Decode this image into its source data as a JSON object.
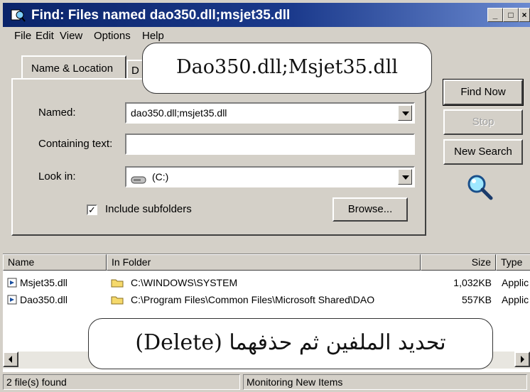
{
  "window": {
    "title": "Find: Files named dao350.dll;msjet35.dll",
    "controls": [
      "_",
      "□",
      "×"
    ]
  },
  "menu": [
    "File",
    "Edit",
    "View",
    "Options",
    "Help"
  ],
  "tabs": [
    {
      "label": "Name & Location",
      "active": true
    },
    {
      "label": "D",
      "active": false
    }
  ],
  "form": {
    "named_label": "Named:",
    "named_value": "dao350.dll;msjet35.dll",
    "containing_label": "Containing text:",
    "containing_value": "",
    "lookin_label": "Look in:",
    "lookin_value": "(C:)",
    "include_subfolders_label": "Include subfolders",
    "include_subfolders_checked": true,
    "browse_label": "Browse..."
  },
  "buttons": {
    "find_now": "Find Now",
    "stop": "Stop",
    "new_search": "New Search"
  },
  "icons": {
    "magnifier": "magnifier-icon",
    "drive": "drive-icon",
    "folder": "folder-icon",
    "file": "dll-file-icon"
  },
  "results": {
    "columns": [
      "Name",
      "In Folder",
      "Size",
      "Type"
    ],
    "rows": [
      {
        "name": "Msjet35.dll",
        "folder": "C:\\WINDOWS\\SYSTEM",
        "size": "1,032KB",
        "type": "Applic"
      },
      {
        "name": "Dao350.dll",
        "folder": "C:\\Program Files\\Common Files\\Microsoft Shared\\DAO",
        "size": "557KB",
        "type": "Applic"
      }
    ]
  },
  "status": {
    "count": "2 file(s) found",
    "monitoring": "Monitoring New Items"
  },
  "callouts": {
    "top": "Dao350.dll;Msjet35.dll",
    "bottom": "تحديد الملفين ثم حذفهما (Delete)"
  },
  "colors": {
    "titlebar": "#0a246a",
    "face": "#d4d0c8",
    "folder": "#f5d96b"
  }
}
